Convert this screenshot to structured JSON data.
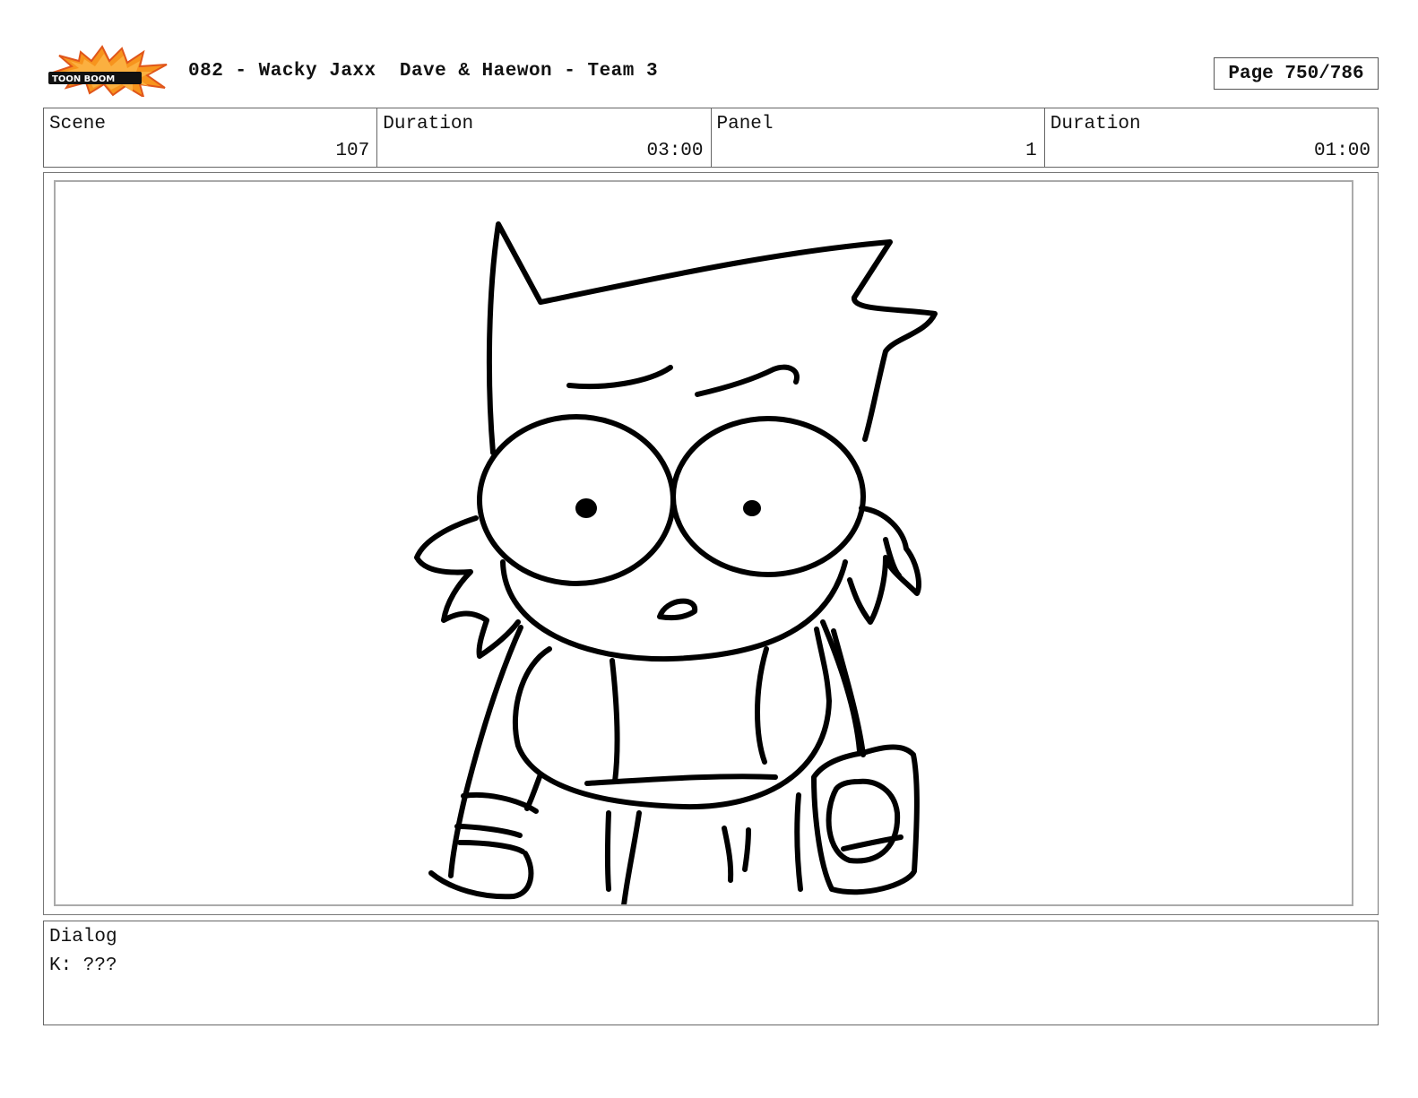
{
  "header": {
    "logo_text": "TOON BOOM",
    "title": "082 - Wacky Jaxx  Dave & Haewon - Team 3",
    "page": "Page 750/786"
  },
  "info": {
    "scene_label": "Scene",
    "scene_value": "107",
    "scene_duration_label": "Duration",
    "scene_duration_value": "03:00",
    "panel_label": "Panel",
    "panel_value": "1",
    "panel_duration_label": "Duration",
    "panel_duration_value": "01:00"
  },
  "dialog": {
    "label": "Dialog",
    "text": "K: ???"
  }
}
